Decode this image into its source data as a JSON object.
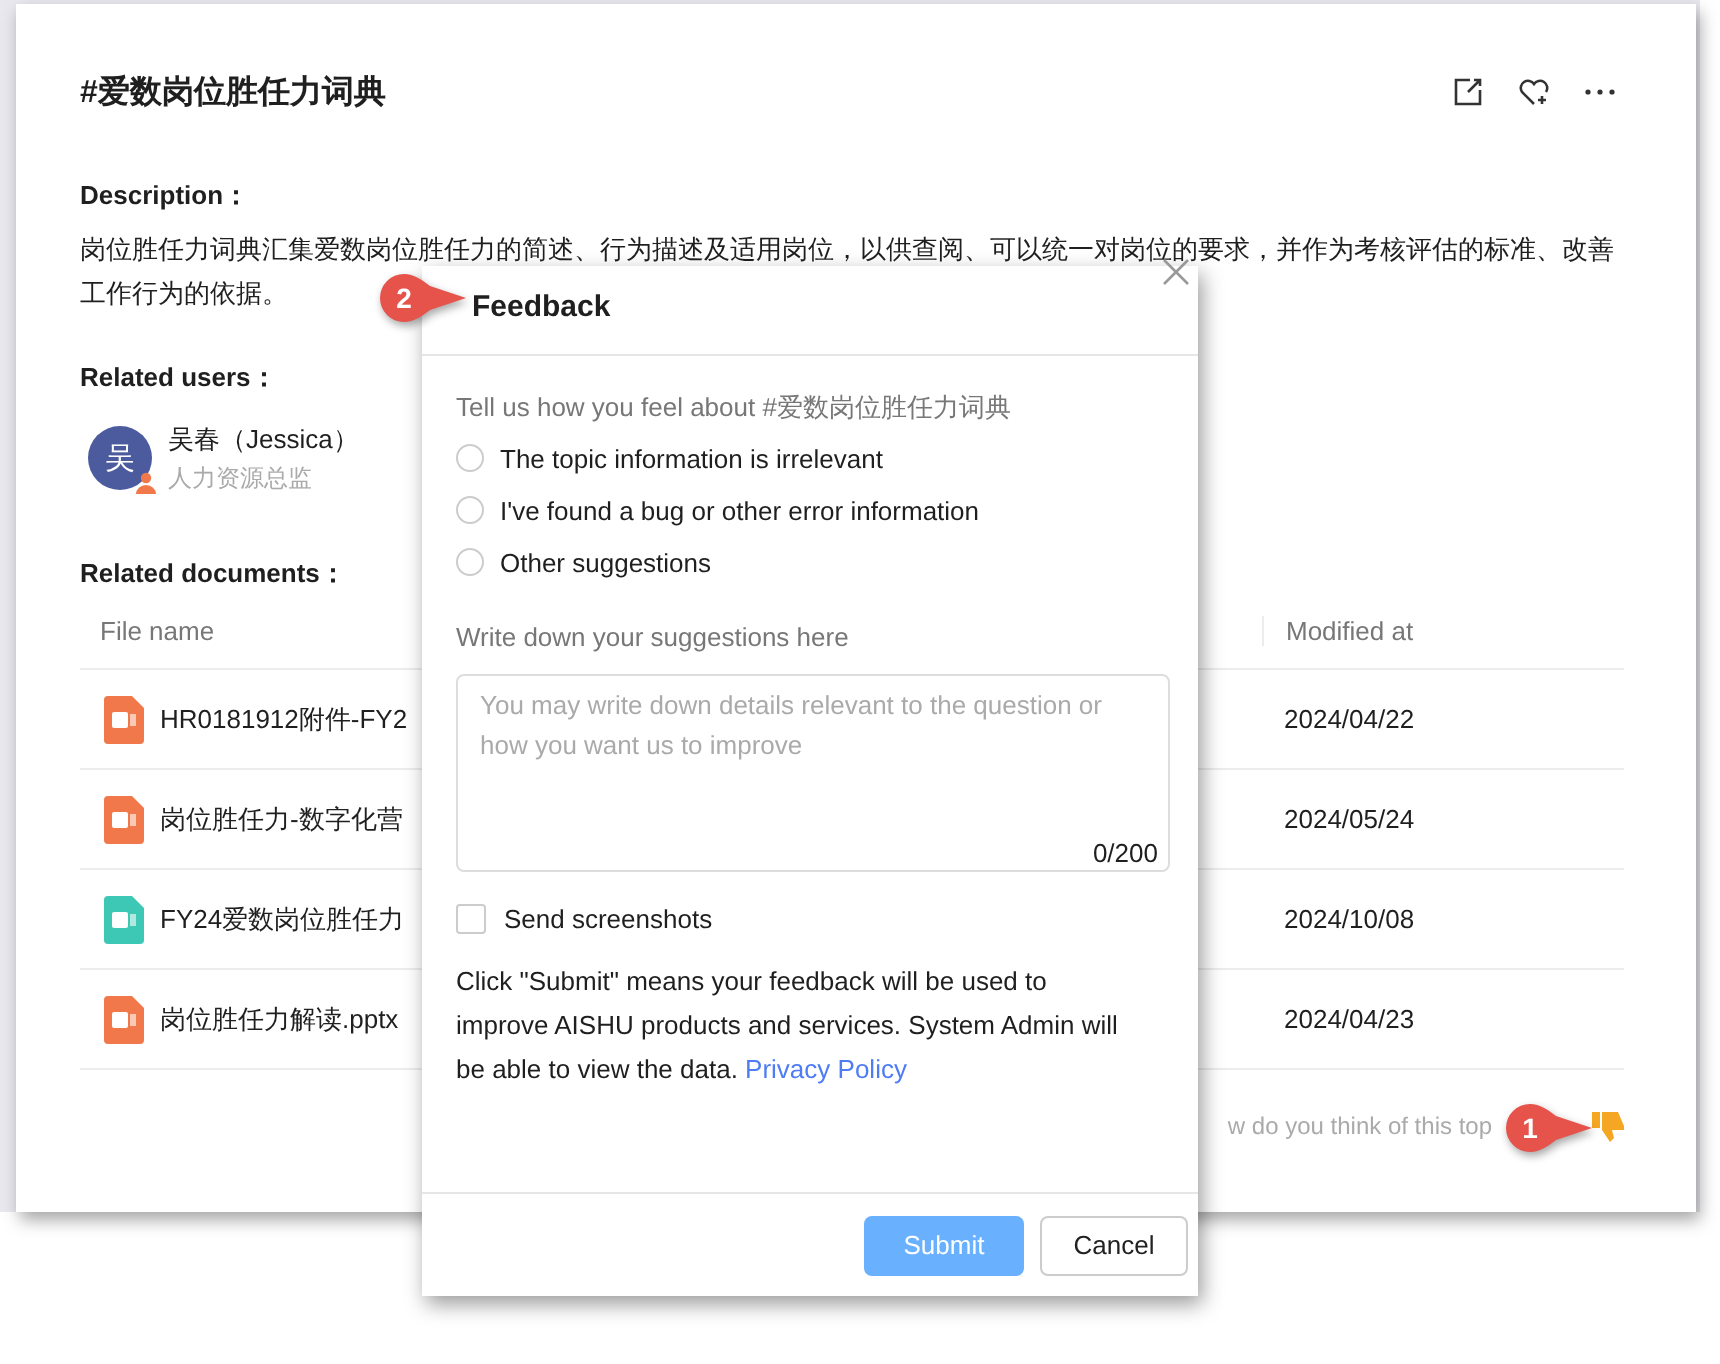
{
  "topic": {
    "title": "#爱数岗位胜任力词典"
  },
  "description": {
    "label": "Description：",
    "lines": [
      "岗位胜任力词典汇集爱数岗位胜任力的简述、行为描述及适用岗位，以供查阅、可以统一对岗位的要求，并作为考核评估的标准、改善",
      "工作行为的依据。"
    ]
  },
  "related_users": {
    "label": "Related users：",
    "users": [
      {
        "avatar": "吴",
        "name": "吴春（Jessica）",
        "role": "人力资源总监"
      }
    ]
  },
  "related_documents": {
    "label": "Related documents：",
    "columns": [
      "File name",
      "Modified at"
    ],
    "rows": [
      {
        "kind": "ppt",
        "name": "HR0181912附件-FY2",
        "modified": "2024/04/22"
      },
      {
        "kind": "ppt",
        "name": "岗位胜任力-数字化营",
        "modified": "2024/05/24"
      },
      {
        "kind": "xls",
        "name": "FY24爱数岗位胜任力",
        "modified": "2024/10/08"
      },
      {
        "kind": "ppt",
        "name": "岗位胜任力解读.pptx",
        "modified": "2024/04/23"
      }
    ]
  },
  "rating_prompt": "w do you think of this top",
  "feedback_dialog": {
    "title": "Feedback",
    "prompt": "Tell us how you feel about #爱数岗位胜任力词典",
    "options": [
      {
        "label": "The topic information is irrelevant",
        "selected": false
      },
      {
        "label": "I've found a bug or other error information",
        "selected": false
      },
      {
        "label": "Other suggestions",
        "selected": false
      }
    ],
    "suggestions_label": "Write down your suggestions here",
    "suggestions": {
      "placeholder": "You may write down details relevant to the question or how you want us to improve",
      "counter": "0/200"
    },
    "screenshot": {
      "label": "Send screenshots",
      "checked": false
    },
    "notice": "Click \"Submit\" means your feedback will be used to\nimprove AISHU products and services. System Admin will\nbe able to view the data.",
    "privacy_link": "Privacy Policy",
    "submit": {
      "label": "Submit",
      "disabled": true
    },
    "cancel": {
      "label": "Cancel"
    }
  },
  "callouts": [
    {
      "number": "1"
    },
    {
      "number": "2"
    }
  ]
}
